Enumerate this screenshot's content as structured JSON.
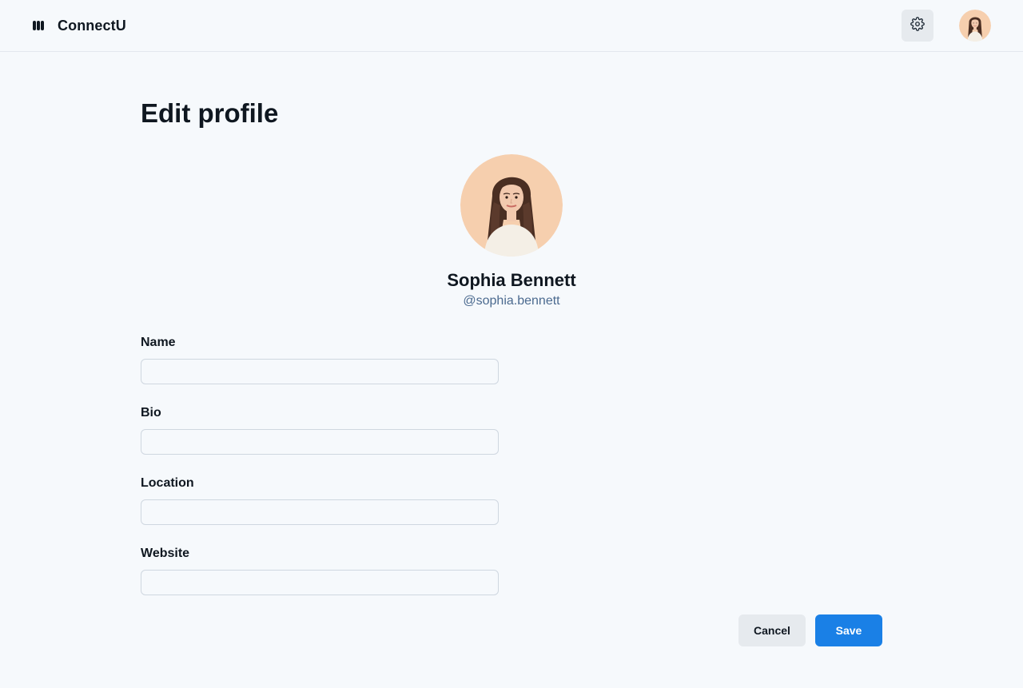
{
  "header": {
    "app_name": "ConnectU",
    "logo_icon": "connectu-logo-icon",
    "settings_icon": "gear-icon"
  },
  "page": {
    "title": "Edit profile"
  },
  "profile": {
    "name": "Sophia Bennett",
    "handle": "@sophia.bennett"
  },
  "form": {
    "fields": [
      {
        "label": "Name",
        "value": "",
        "placeholder": ""
      },
      {
        "label": "Bio",
        "value": "",
        "placeholder": ""
      },
      {
        "label": "Location",
        "value": "",
        "placeholder": ""
      },
      {
        "label": "Website",
        "value": "",
        "placeholder": ""
      }
    ]
  },
  "actions": {
    "cancel_label": "Cancel",
    "save_label": "Save"
  },
  "colors": {
    "background": "#f6f9fc",
    "accent": "#1a80e6",
    "secondary_button": "#e6eaee",
    "handle_text": "#4b6a8f"
  }
}
